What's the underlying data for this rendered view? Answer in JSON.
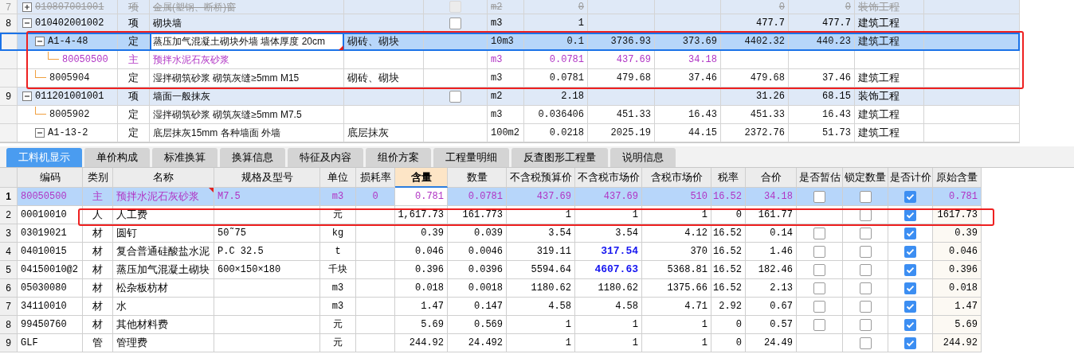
{
  "top_table": {
    "rows": [
      {
        "num": "7",
        "code": "010807001001",
        "type": "项",
        "name": "金属(塑钢、断桥)窗",
        "spec": "",
        "checked": false,
        "unit": "m2",
        "quantity": "0",
        "col_8": "",
        "col_9": "",
        "col_10": "0",
        "col_11": "0",
        "specialty": "装饰工程",
        "kind": "item",
        "selected": false,
        "disabled": true,
        "flagged": false,
        "expanded": false
      },
      {
        "num": "8",
        "code": "010402001002",
        "type": "项",
        "name": "砌块墙",
        "spec": "",
        "checked": false,
        "unit": "m3",
        "quantity": "1",
        "col_8": "",
        "col_9": "",
        "col_10": "477.7",
        "col_11": "477.7",
        "specialty": "建筑工程",
        "kind": "item",
        "selected": false,
        "disabled": false,
        "flagged": false,
        "expanded": true,
        "children": [
          {
            "code": "A1-4-48",
            "type": "定",
            "name": "蒸压加气混凝土砌块外墙 墙体厚度 20cm",
            "spec": "砌砖、砌块",
            "unit": "10m3",
            "quantity": "0.1",
            "col_8": "3736.93",
            "col_9": "373.69",
            "col_10": "4402.32",
            "col_11": "440.23",
            "specialty": "建筑工程",
            "kind": "quota",
            "selected": true,
            "disabled": false,
            "flagged": true,
            "expanded": true,
            "children": [
              {
                "code": "80050500",
                "type": "主",
                "name": "预拌水泥石灰砂浆",
                "unit": "m3",
                "quantity": "0.0781",
                "col_8": "437.69",
                "col_9": "34.18",
                "kind": "main",
                "selected": false,
                "disabled": false,
                "flagged": false
              }
            ]
          },
          {
            "code": "8005904",
            "type": "定",
            "name": "湿拌砌筑砂浆 砌筑灰缝≥5mm M15",
            "spec": "砌砖、砌块",
            "unit": "m3",
            "quantity": "0.0781",
            "col_8": "479.68",
            "col_9": "37.46",
            "col_10": "479.68",
            "col_11": "37.46",
            "specialty": "建筑工程",
            "kind": "quota",
            "selected": false,
            "disabled": false,
            "flagged": false
          }
        ]
      },
      {
        "num": "9",
        "code": "011201001001",
        "type": "项",
        "name": "墙面一般抹灰",
        "spec": "",
        "checked": false,
        "unit": "m2",
        "quantity": "2.18",
        "col_8": "",
        "col_9": "",
        "col_10": "31.26",
        "col_11": "68.15",
        "specialty": "装饰工程",
        "kind": "item",
        "selected": false,
        "disabled": false,
        "flagged": false,
        "expanded": true,
        "children": [
          {
            "code": "8005902",
            "type": "定",
            "name": "湿拌砌筑砂浆 砌筑灰缝≥5mm M7.5",
            "unit": "m3",
            "quantity": "0.036406",
            "col_8": "451.33",
            "col_9": "16.43",
            "col_10": "451.33",
            "col_11": "16.43",
            "specialty": "建筑工程",
            "kind": "quota",
            "selected": false,
            "disabled": false,
            "flagged": false
          },
          {
            "code": "A1-13-2",
            "type": "定",
            "name": "底层抹灰15mm 各种墙面 外墙",
            "spec": "底层抹灰",
            "unit": "100m2",
            "quantity": "0.0218",
            "col_8": "2025.19",
            "col_9": "44.15",
            "col_10": "2372.76",
            "col_11": "51.73",
            "specialty": "建筑工程",
            "kind": "quota",
            "selected": false,
            "disabled": false,
            "flagged": false,
            "expanded": true
          }
        ]
      }
    ]
  },
  "tabs": [
    {
      "label": "工料机显示",
      "selected": true
    },
    {
      "label": "单价构成",
      "selected": false
    },
    {
      "label": "标准换算",
      "selected": false
    },
    {
      "label": "换算信息",
      "selected": false
    },
    {
      "label": "特征及内容",
      "selected": false
    },
    {
      "label": "组价方案",
      "selected": false
    },
    {
      "label": "工程量明细",
      "selected": false
    },
    {
      "label": "反查图形工程量",
      "selected": false
    },
    {
      "label": "说明信息",
      "selected": false
    }
  ],
  "detail_table": {
    "columns": [
      {
        "label": "编码",
        "selected": false
      },
      {
        "label": "类别",
        "selected": false
      },
      {
        "label": "名称",
        "selected": false
      },
      {
        "label": "规格及型号",
        "selected": false
      },
      {
        "label": "单位",
        "selected": false
      },
      {
        "label": "损耗率",
        "selected": false
      },
      {
        "label": "含量",
        "selected": true
      },
      {
        "label": "数量",
        "selected": false
      },
      {
        "label": "不含税预算价",
        "selected": false
      },
      {
        "label": "不含税市场价",
        "selected": false
      },
      {
        "label": "含税市场价",
        "selected": false
      },
      {
        "label": "税率",
        "selected": false
      },
      {
        "label": "合价",
        "selected": false
      },
      {
        "label": "是否暂估",
        "selected": false
      },
      {
        "label": "锁定数量",
        "selected": false
      },
      {
        "label": "是否计价",
        "selected": false
      },
      {
        "label": "原始含量",
        "selected": false
      }
    ],
    "rows": [
      {
        "num": "1",
        "selected": true,
        "kind": "main",
        "flagged": true,
        "code": "80050500",
        "type": "主",
        "name": "预拌水泥石灰砂浆",
        "spec": "M7.5",
        "unit": "m3",
        "loss": "0",
        "content": "0.781",
        "quantity": "0.0781",
        "budget_price": "437.69",
        "market_price": "437.69",
        "market_changed": false,
        "tax_price": "510",
        "tax_rate": "16.52",
        "total": "34.18",
        "estimated": false,
        "locked": false,
        "priced": true,
        "original": "0.781"
      },
      {
        "num": "2",
        "selected": false,
        "kind": "normal",
        "flagged": false,
        "code": "00010010",
        "type": "人",
        "name": "人工费",
        "spec": "",
        "unit": "元",
        "loss": "",
        "content": "1,617.73",
        "quantity": "161.773",
        "budget_price": "1",
        "market_price": "1",
        "market_changed": false,
        "tax_price": "1",
        "tax_rate": "0",
        "total": "161.77",
        "locked": false,
        "priced": true,
        "original": "1617.73"
      },
      {
        "num": "3",
        "selected": false,
        "kind": "normal",
        "flagged": false,
        "code": "03019021",
        "type": "材",
        "name": "圆钉",
        "spec": "50˜75",
        "unit": "kg",
        "loss": "",
        "content": "0.39",
        "quantity": "0.039",
        "budget_price": "3.54",
        "market_price": "3.54",
        "market_changed": false,
        "tax_price": "4.12",
        "tax_rate": "16.52",
        "total": "0.14",
        "estimated": false,
        "locked": false,
        "priced": true,
        "original": "0.39"
      },
      {
        "num": "4",
        "selected": false,
        "kind": "normal",
        "flagged": false,
        "code": "04010015",
        "type": "材",
        "name": "复合普通硅酸盐水泥",
        "spec": "P.C 32.5",
        "unit": "t",
        "loss": "",
        "content": "0.046",
        "quantity": "0.0046",
        "budget_price": "319.11",
        "market_price": "317.54",
        "market_changed": true,
        "tax_price": "370",
        "tax_rate": "16.52",
        "total": "1.46",
        "estimated": false,
        "locked": false,
        "priced": true,
        "original": "0.046"
      },
      {
        "num": "5",
        "selected": false,
        "kind": "normal",
        "flagged": false,
        "code": "04150010@2",
        "type": "材",
        "name": "蒸压加气混凝土砌块",
        "spec": "600×150×180",
        "unit": "千块",
        "loss": "",
        "content": "0.396",
        "quantity": "0.0396",
        "budget_price": "5594.64",
        "market_price": "4607.63",
        "market_changed": true,
        "tax_price": "5368.81",
        "tax_rate": "16.52",
        "total": "182.46",
        "estimated": false,
        "locked": false,
        "priced": true,
        "original": "0.396"
      },
      {
        "num": "6",
        "selected": false,
        "kind": "normal",
        "flagged": false,
        "code": "05030080",
        "type": "材",
        "name": "松杂板枋材",
        "spec": "",
        "unit": "m3",
        "loss": "",
        "content": "0.018",
        "quantity": "0.0018",
        "budget_price": "1180.62",
        "market_price": "1180.62",
        "market_changed": false,
        "tax_price": "1375.66",
        "tax_rate": "16.52",
        "total": "2.13",
        "estimated": false,
        "locked": false,
        "priced": true,
        "original": "0.018"
      },
      {
        "num": "7",
        "selected": false,
        "kind": "normal",
        "flagged": false,
        "code": "34110010",
        "type": "材",
        "name": "水",
        "spec": "",
        "unit": "m3",
        "loss": "",
        "content": "1.47",
        "quantity": "0.147",
        "budget_price": "4.58",
        "market_price": "4.58",
        "market_changed": false,
        "tax_price": "4.71",
        "tax_rate": "2.92",
        "total": "0.67",
        "estimated": false,
        "locked": false,
        "priced": true,
        "original": "1.47"
      },
      {
        "num": "8",
        "selected": false,
        "kind": "normal",
        "flagged": false,
        "code": "99450760",
        "type": "材",
        "name": "其他材料费",
        "spec": "",
        "unit": "元",
        "loss": "",
        "content": "5.69",
        "quantity": "0.569",
        "budget_price": "1",
        "market_price": "1",
        "market_changed": false,
        "tax_price": "1",
        "tax_rate": "0",
        "total": "0.57",
        "estimated": false,
        "locked": false,
        "priced": true,
        "original": "5.69"
      },
      {
        "num": "9",
        "selected": false,
        "kind": "normal",
        "flagged": false,
        "code": "GLF",
        "type": "管",
        "name": "管理费",
        "spec": "",
        "unit": "元",
        "loss": "",
        "content": "244.92",
        "quantity": "24.492",
        "budget_price": "1",
        "market_price": "1",
        "market_changed": false,
        "tax_price": "1",
        "tax_rate": "0",
        "total": "24.49",
        "locked": false,
        "priced": true,
        "original": "244.92"
      }
    ]
  }
}
